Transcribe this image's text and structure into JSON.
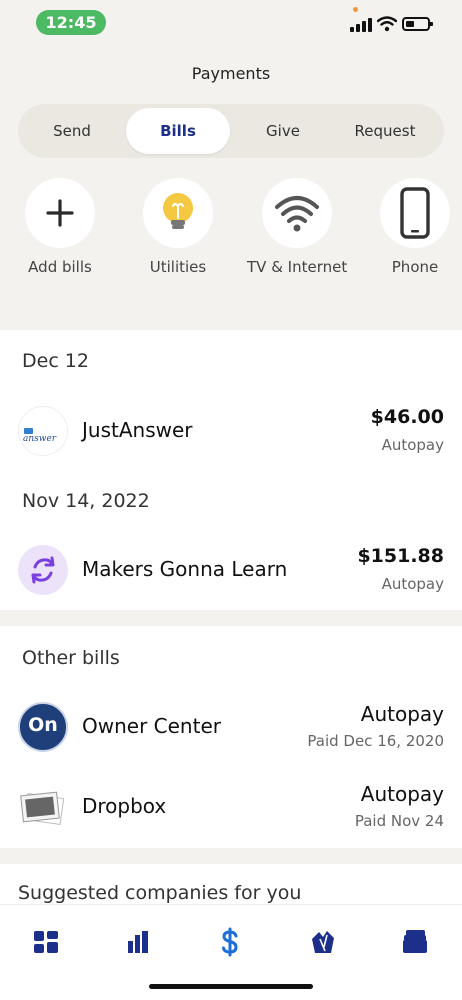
{
  "status_bar": {
    "time": "12:45"
  },
  "header": {
    "title": "Payments"
  },
  "tabs": [
    {
      "label": "Send",
      "active": false
    },
    {
      "label": "Bills",
      "active": true
    },
    {
      "label": "Give",
      "active": false
    },
    {
      "label": "Request",
      "active": false
    }
  ],
  "categories": [
    {
      "label": "Add bills",
      "icon": "plus-icon"
    },
    {
      "label": "Utilities",
      "icon": "lightbulb-icon"
    },
    {
      "label": "TV & Internet",
      "icon": "wifi-icon"
    },
    {
      "label": "Phone",
      "icon": "phone-icon"
    }
  ],
  "upcoming": [
    {
      "date": "Dec 12",
      "payee": "JustAnswer",
      "logo_text": "answer",
      "amount": "$46.00",
      "status": "Autopay"
    },
    {
      "date": "Nov 14, 2022",
      "payee": "Makers Gonna Learn",
      "amount": "$151.88",
      "status": "Autopay"
    }
  ],
  "other_bills": {
    "heading": "Other bills",
    "items": [
      {
        "payee": "Owner Center",
        "logo_text": "On",
        "amount": "Autopay",
        "status": "Paid Dec 16, 2020"
      },
      {
        "payee": "Dropbox",
        "amount": "Autopay",
        "status": "Paid Nov 24"
      }
    ]
  },
  "suggested": {
    "heading": "Suggested companies for you"
  },
  "bottom_nav": [
    "home-icon",
    "activity-icon",
    "dollar-icon",
    "deals-icon",
    "wallet-icon"
  ],
  "colors": {
    "accent": "#1c2f8a",
    "background": "#f4f2ee",
    "status_pill": "#4cb963",
    "bulb": "#f5c842"
  }
}
